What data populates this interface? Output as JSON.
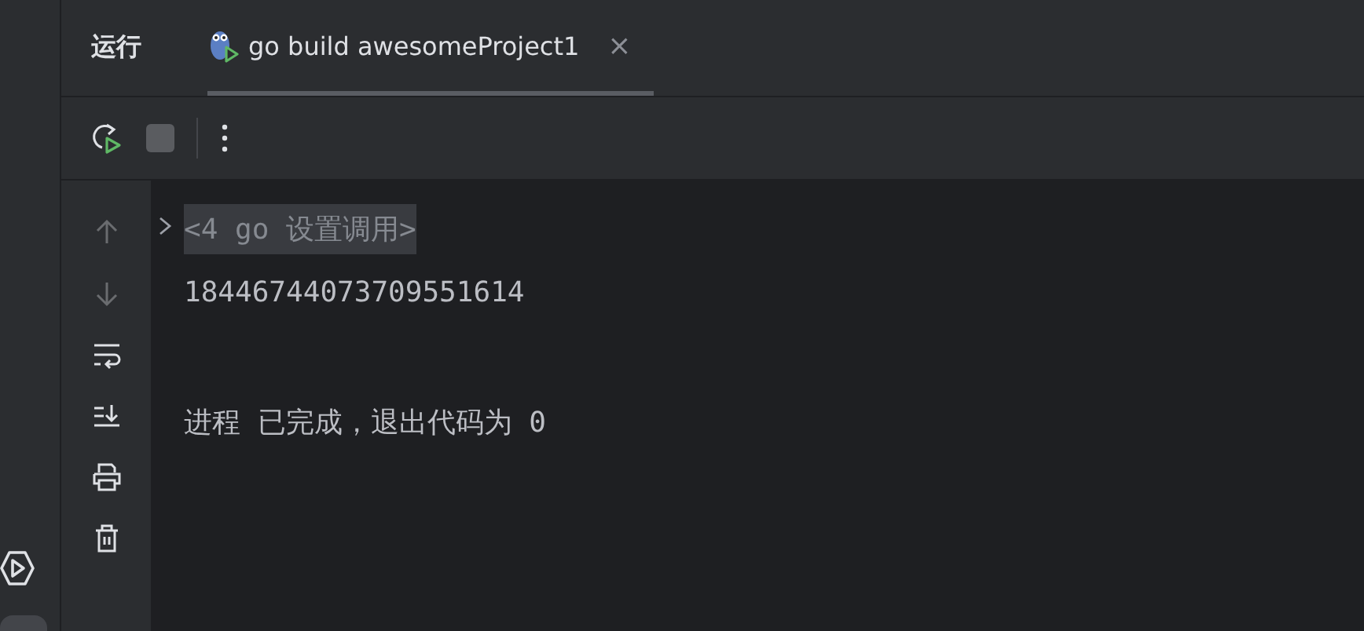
{
  "panel": {
    "title": "运行"
  },
  "tabs": [
    {
      "label": "go build awesomeProject1",
      "selected": true,
      "close": "×"
    }
  ],
  "toolbar": [
    {
      "kind": "rerun",
      "disabled": false
    },
    {
      "kind": "stop",
      "disabled": true
    },
    {
      "kind": "more",
      "disabled": false
    }
  ],
  "gutter_tools": [
    {
      "kind": "up",
      "disabled": true
    },
    {
      "kind": "down",
      "disabled": true
    },
    {
      "kind": "wrap",
      "disabled": false
    },
    {
      "kind": "scroll-end",
      "disabled": false
    },
    {
      "kind": "print",
      "disabled": false
    },
    {
      "kind": "trash",
      "disabled": false
    }
  ],
  "console": [
    {
      "kind": "folded",
      "text": "<4 go 设置调用>",
      "expanded": false
    },
    {
      "kind": "output",
      "text": "18446744073709551614"
    },
    {
      "kind": "blank"
    },
    {
      "kind": "output",
      "text": "进程 已完成，退出代码为 0"
    }
  ]
}
